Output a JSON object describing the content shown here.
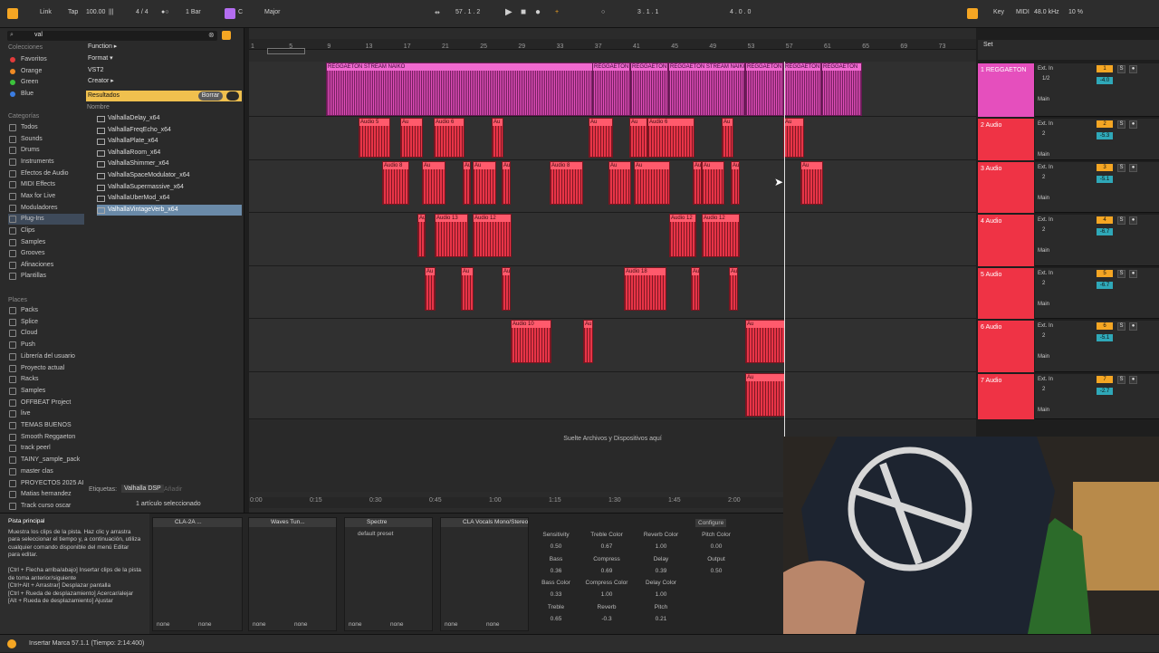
{
  "topbar": {
    "link": "Link",
    "tap": "Tap",
    "tempo": "100.00",
    "meter": "4 / 4",
    "quant": "1 Bar",
    "key_root": "C",
    "scale": "Major",
    "position": "57 . 1 . 2",
    "loop_start": "3 . 1 . 1",
    "loop_len": "4 . 0 . 0",
    "key": "Key",
    "midi": "MIDI",
    "sample_rate": "48.0 kHz",
    "cpu": "10 %"
  },
  "browser": {
    "search": "val",
    "collections_title": "Colecciones",
    "collections": [
      {
        "label": "Favoritos",
        "color": "#e23b3b"
      },
      {
        "label": "Orange",
        "color": "#f08a24"
      },
      {
        "label": "Green",
        "color": "#3cc23c"
      },
      {
        "label": "Blue",
        "color": "#3b7de2"
      }
    ],
    "categories_title": "Categorías",
    "categories": [
      "Todos",
      "Sounds",
      "Drums",
      "Instruments",
      "Efectos de Audio",
      "MIDI Effects",
      "Max for Live",
      "Moduladores",
      "Plug-Ins",
      "Clips",
      "Samples",
      "Grooves",
      "Afinaciones",
      "Plantillas"
    ],
    "places_title": "Places",
    "places": [
      "Packs",
      "Splice",
      "Cloud",
      "Push",
      "Librería del usuario",
      "Proyecto actual",
      "Racks",
      "Samples",
      "OFFBEAT Project",
      "live",
      "TEMAS BUENOS",
      "Smooth Reggaeton",
      "track peerl",
      "TAINY_sample_pack",
      "master clas",
      "PROYECTOS 2025 AI",
      "Matias hernandez",
      "Track curso oscar"
    ],
    "filters": [
      "Function ▸",
      "Format ▾",
      "VST2",
      "Creator ▸"
    ],
    "results_label": "Resultados",
    "clear": "Borrar",
    "name_col": "Nombre",
    "results": [
      "ValhallaDelay_x64",
      "ValhallaFreqEcho_x64",
      "ValhallaPlate_x64",
      "ValhallaRoom_x64",
      "ValhallaShimmer_x64",
      "ValhallaSpaceModulator_x64",
      "ValhallaSupermassive_x64",
      "ValhallaUberMod_x64",
      "ValhallaVintageVerb_x64"
    ],
    "tags_label": "Etiquetas:",
    "tag": "Valhalla DSP",
    "add": "Añadir",
    "selected": "1 artículo seleccionado"
  },
  "ruler": [
    "1",
    "5",
    "9",
    "13",
    "17",
    "21",
    "25",
    "29",
    "33",
    "37",
    "41",
    "45",
    "49",
    "53",
    "57",
    "61",
    "65",
    "69",
    "73"
  ],
  "time_ruler": [
    "0:00",
    "0:15",
    "0:30",
    "0:45",
    "1:00",
    "1:15",
    "1:30",
    "1:45",
    "2:00"
  ],
  "drop_hint": "Suelte Archivos y Dispositivos aquí",
  "set_label": "Set",
  "tracks": [
    {
      "name": "1 REGGAETON",
      "input": "Ext. In",
      "ch": "1/2",
      "out": "Main",
      "num": "1",
      "vol": "-4.0",
      "color": "#e54fbd"
    },
    {
      "name": "2 Audio",
      "input": "Ext. In",
      "ch": "2",
      "out": "Main",
      "num": "2",
      "vol": "-5.3",
      "color": "#ef3345"
    },
    {
      "name": "3 Audio",
      "input": "Ext. In",
      "ch": "2",
      "out": "Main",
      "num": "3",
      "vol": "-5.1",
      "color": "#ef3345"
    },
    {
      "name": "4 Audio",
      "input": "Ext. In",
      "ch": "2",
      "out": "Main",
      "num": "4",
      "vol": "-6.7",
      "color": "#ef3345"
    },
    {
      "name": "5 Audio",
      "input": "Ext. In",
      "ch": "2",
      "out": "Main",
      "num": "5",
      "vol": "-6.7",
      "color": "#ef3345"
    },
    {
      "name": "6 Audio",
      "input": "Ext. In",
      "ch": "2",
      "out": "Main",
      "num": "6",
      "vol": "-5.1",
      "color": "#ef3345"
    },
    {
      "name": "7 Audio",
      "input": "Ext. In",
      "ch": "2",
      "out": "Main",
      "num": "7",
      "vol": "-2.7",
      "color": "#ef3345"
    }
  ],
  "clip_names": {
    "reggaeton": "REGGAETON STREAM NAIKO",
    "reggaeton_short": "REGGAETON",
    "audio5": "Audio 5",
    "audio6": "Audio 6",
    "audio8": "Audio 8",
    "audio13": "Audio 13",
    "audio12": "Audio 12",
    "audio18": "Audio 18",
    "audio10": "Audio 10",
    "au": "Au"
  },
  "info": {
    "title": "Pista principal",
    "text": "Muestra los clips de la pista. Haz clic y arrastra para seleccionar el tiempo y, a continuación, utiliza cualquier comando disponible del menú Editar para editar.",
    "shortcuts": "[Ctrl + Flecha arriba/abajo] Insertar clips de la pista de toma anterior/siguiente\n[Ctrl+Alt + Arrastrar] Desplazar pantalla\n[Ctrl + Rueda de desplazamiento] Acercar/alejar\n[Alt + Rueda de desplazamiento] Ajustar"
  },
  "devices": [
    {
      "name": "CLA-2A ..."
    },
    {
      "name": "Waves Tun..."
    },
    {
      "name": "Spectre",
      "preset": "default preset"
    },
    {
      "name": "CLA Vocals Mono/Stereo",
      "configure": "Configure"
    }
  ],
  "none": "none",
  "macros": [
    {
      "label": "Sensitivity",
      "value": "0.50"
    },
    {
      "label": "Treble Color",
      "value": "0.67"
    },
    {
      "label": "Reverb Color",
      "value": "1.00"
    },
    {
      "label": "Pitch Color",
      "value": "0.00"
    },
    {
      "label": "Bass",
      "value": "0.36"
    },
    {
      "label": "Compress",
      "value": "0.69"
    },
    {
      "label": "Delay",
      "value": "0.39"
    },
    {
      "label": "Output",
      "value": "0.50"
    },
    {
      "label": "Bass Color",
      "value": "0.33"
    },
    {
      "label": "Compress Color",
      "value": "1.00"
    },
    {
      "label": "Delay Color",
      "value": "1.00"
    },
    {
      "label": "Treble",
      "value": "0.65"
    },
    {
      "label": "Reverb",
      "value": "-0.3"
    },
    {
      "label": "Pitch",
      "value": "0.21"
    }
  ],
  "status": "Insertar Marca 57.1.1 (Tiempo: 2:14:400)"
}
